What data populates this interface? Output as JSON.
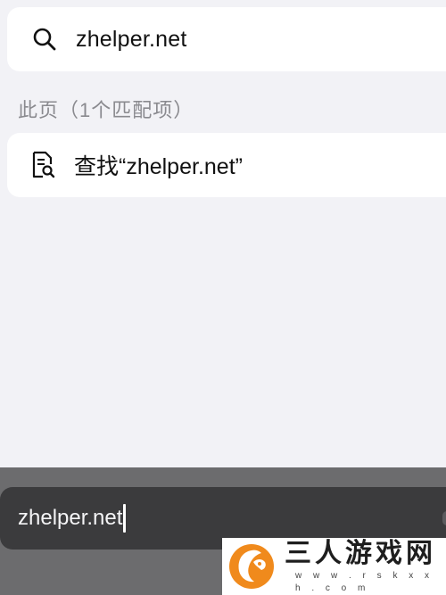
{
  "suggestion": {
    "icon": "search-icon",
    "text": "zhelper.net"
  },
  "section": {
    "header": "此页（1个匹配项）"
  },
  "find_on_page": {
    "icon": "find-in-page-icon",
    "text": "查找“zhelper.net”"
  },
  "address_bar": {
    "value": "zhelper.net"
  },
  "watermark": {
    "brand": "三人游戏网",
    "domain": "w w w . r s k x x h . c o m",
    "accent": "#f08a1c"
  },
  "colors": {
    "background": "#f2f2f6",
    "card": "#ffffff",
    "secondary_text": "#8a8a8f",
    "toolbar": "#6c6c6e",
    "address_bar": "#3b3b3d"
  }
}
